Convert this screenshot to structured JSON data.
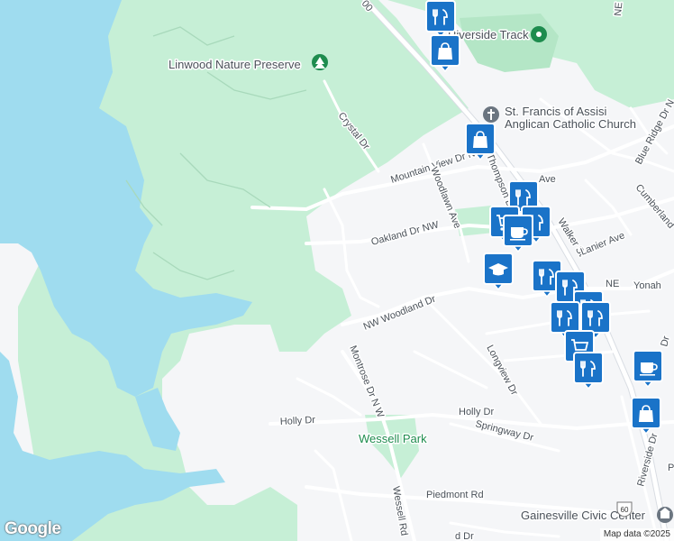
{
  "map": {
    "poi_labels": {
      "linwood": "Linwood Nature Preserve",
      "riverside_track": "Riverside Track",
      "st_francis_1": "St. Francis of Assisi",
      "st_francis_2": "Anglican Catholic Church",
      "wessell_park": "Wessell Park",
      "civic_center": "Gainesville Civic Center"
    },
    "streets": {
      "crystal": "Crystal Dr",
      "mountain_view": "Mountain View Dr N",
      "woodlawn": "Woodlawn Ave",
      "thompson": "Thompson B",
      "oakland": "Oakland Dr NW",
      "walker": "Walker St",
      "lanier": "Lanier Ave",
      "blue_ridge": "Blue Ridge Dr N",
      "cumberland": "Cumberland",
      "yonah": "Yonah",
      "ne": "NE",
      "nw_woodland": "NW Woodland Dr",
      "montrose": "Montrose Dr N W",
      "longview": "Longview Dr",
      "holly_w": "Holly Dr",
      "holly_e": "Holly Dr",
      "springway": "Springway Dr",
      "piedmont": "Piedmont Rd",
      "wessell_rd": "Wessell Rd",
      "riverside_dr": "Riverside Dr",
      "ave": "Ave",
      "dr_small": "Dr",
      "ne_top": "NE",
      "p_frag": "P",
      "d_frag": "d Dr",
      "oo_frag": "00"
    },
    "route_shield": "60",
    "attribution": "Map data ©2025",
    "logo": "Google",
    "colors": {
      "water": "#9fdcef",
      "park": "#c6efd6",
      "park_dark": "#b4e6c6",
      "road": "#ffffff",
      "land": "#f5f6f8",
      "pin": "#1a73c8"
    },
    "pins": [
      {
        "name": "restaurant-icon"
      },
      {
        "name": "shopping-bag-icon"
      },
      {
        "name": "shopping-bag-icon"
      },
      {
        "name": "restaurant-icon"
      },
      {
        "name": "restaurant-icon"
      },
      {
        "name": "shopping-cart-icon"
      },
      {
        "name": "cafe-icon"
      },
      {
        "name": "school-icon"
      },
      {
        "name": "restaurant-icon"
      },
      {
        "name": "restaurant-icon"
      },
      {
        "name": "restaurant-icon"
      },
      {
        "name": "restaurant-icon"
      },
      {
        "name": "restaurant-icon"
      },
      {
        "name": "shopping-cart-icon"
      },
      {
        "name": "restaurant-icon"
      },
      {
        "name": "cafe-icon"
      },
      {
        "name": "shopping-bag-icon"
      }
    ]
  }
}
